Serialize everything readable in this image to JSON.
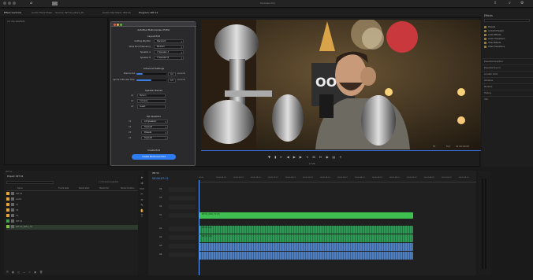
{
  "app": {
    "title": "Premiere Pro"
  },
  "tabs": [
    {
      "label": "Effect Controls"
    },
    {
      "label": "Audio Track Mixer"
    },
    {
      "label": "Source: INT 01_0011_TC"
    },
    {
      "label": "Audio Clip Mixer: INT 01"
    },
    {
      "label": "Program: INT 01"
    }
  ],
  "dialog": {
    "title": "Autoflow Multi-Camera Editor",
    "sections": {
      "layout": "Layout Edit",
      "advanced": "Advanced Settings",
      "speaker_names": "Speaker Names",
      "pip": "Pip Speakers",
      "create": "Create Edit"
    },
    "fields": [
      {
        "label": "Cutting Rhythm",
        "value": "Standard"
      },
      {
        "label": "Wide Shot Frequency",
        "value": "Medium"
      },
      {
        "label": "Speaker A",
        "value": "V Speaker A"
      },
      {
        "label": "Speaker B",
        "value": "V Speaker B"
      }
    ],
    "sliders": [
      {
        "label": "Silence Cut",
        "value": 0.2,
        "unit": "seconds"
      },
      {
        "label": "Ignore Cuts Less Than",
        "value": 0.5,
        "unit": "seconds"
      }
    ],
    "names": [
      {
        "key": "A1",
        "value": "Person"
      },
      {
        "key": "A2",
        "value": "Comedy"
      },
      {
        "key": "A3",
        "value": "Guest"
      }
    ],
    "pip_rows": [
      {
        "key": "V1",
        "value": "All Speakers"
      },
      {
        "key": "V2",
        "value": "Top/Left"
      },
      {
        "key": "V3",
        "value": "Presets"
      },
      {
        "key": "V4",
        "value": "Top/Left"
      }
    ],
    "create_button": "Create Multi-Cam Edit"
  },
  "program": {
    "fit": "Fit",
    "timecode": "01:00:00:00",
    "quality": "Full"
  },
  "project": {
    "title": "Project: INT 01",
    "search_placeholder": "",
    "items_count": "1 of 6 items selected",
    "columns": [
      "Name",
      "Frame Rate",
      "Media Start",
      "Media End",
      "Media Duration"
    ],
    "rows": [
      {
        "name": "INT 01",
        "color": "#e2a33a"
      },
      {
        "name": "Audio",
        "color": "#e2a33a"
      },
      {
        "name": "V1",
        "color": "#e2a33a"
      },
      {
        "name": "V2",
        "color": "#e2a33a"
      },
      {
        "name": "V3",
        "color": "#e2a33a"
      },
      {
        "name": "INT 01",
        "color": "#3fa34d"
      },
      {
        "name": "INT 01_0011_TC",
        "color": "#7fbf3f"
      }
    ]
  },
  "timeline": {
    "name": "INT 01",
    "timecode": "00:00:07:11",
    "ruler": [
      "00:00",
      "00:00:04:23",
      "00:00:09:23",
      "00:00:14:23",
      "00:00:19:23",
      "00:00:24:23",
      "00:00:29:23",
      "00:00:34:23",
      "00:00:39:23",
      "00:00:44:23",
      "00:00:49:23",
      "00:00:54:23",
      "00:00:59:22",
      "00:01:04:22",
      "00:01:09:22",
      "00:01:14:22"
    ],
    "tracks": [
      {
        "label": "V4",
        "clip": "",
        "color": ""
      },
      {
        "label": "V3",
        "clip": "",
        "color": ""
      },
      {
        "label": "V2",
        "clip": "",
        "color": ""
      },
      {
        "label": "V1",
        "clip": "INT 01_0011_TC [V]",
        "color": "#3fbf4f"
      },
      {
        "label": "A1",
        "clip": "INT 01 (A1)",
        "color": "#2f9a55"
      },
      {
        "label": "A2",
        "clip": "INT 01 (A2)",
        "color": "#2f9a55"
      },
      {
        "label": "A3",
        "clip": "",
        "color": "#4f7fbf"
      },
      {
        "label": "A4",
        "clip": "",
        "color": "#4f7fbf"
      }
    ]
  },
  "right_panel": {
    "title": "Effects",
    "items": [
      "Presets",
      "Lumetri Presets",
      "Audio Effects",
      "Audio Transitions",
      "Video Effects",
      "Video Transitions"
    ],
    "sections": [
      "Essential Graphics",
      "Essential Sound",
      "Lumetri Color",
      "Libraries",
      "Markers",
      "History",
      "Info"
    ]
  },
  "colors": {
    "accent": "#2d7cf0",
    "clip_video": "#3fbf4f",
    "clip_audio": "#2f9a55",
    "clip_audio2": "#4f7fbf",
    "playhead": "#5aa0ff"
  }
}
